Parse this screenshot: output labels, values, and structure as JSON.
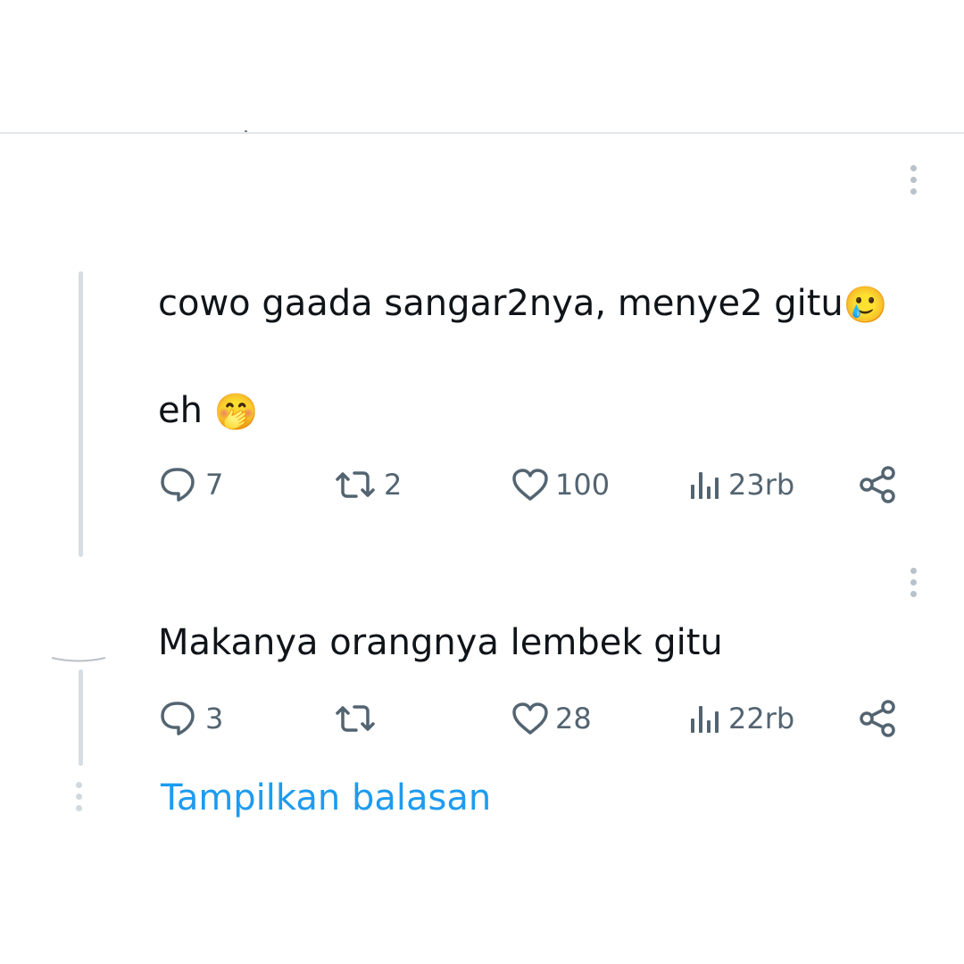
{
  "tweets": [
    {
      "text_line1": "cowo gaada sangar2nya, menye2 gitu",
      "emoji_line1": "🥲",
      "text_line2": "eh ",
      "emoji_line2": "🤭",
      "replies": "7",
      "reposts": "2",
      "likes": "100",
      "views": "23rb"
    },
    {
      "text_line1": "Makanya orangnya lembek gitu",
      "replies": "3",
      "reposts": "",
      "likes": "28",
      "views": "22rb"
    }
  ],
  "show_replies_label": "Tampilkan balasan",
  "icons": {
    "reply": "speech-bubble-icon",
    "repost": "repost-arrows-icon",
    "like": "heart-icon",
    "views": "bar-chart-icon",
    "share": "share-nodes-icon",
    "more": "vertical-ellipsis-icon"
  },
  "colors": {
    "text": "#0f1419",
    "muted": "#536471",
    "link": "#1d9bf0",
    "thread_line": "#d6dde3",
    "divider": "#e4e8eb"
  }
}
